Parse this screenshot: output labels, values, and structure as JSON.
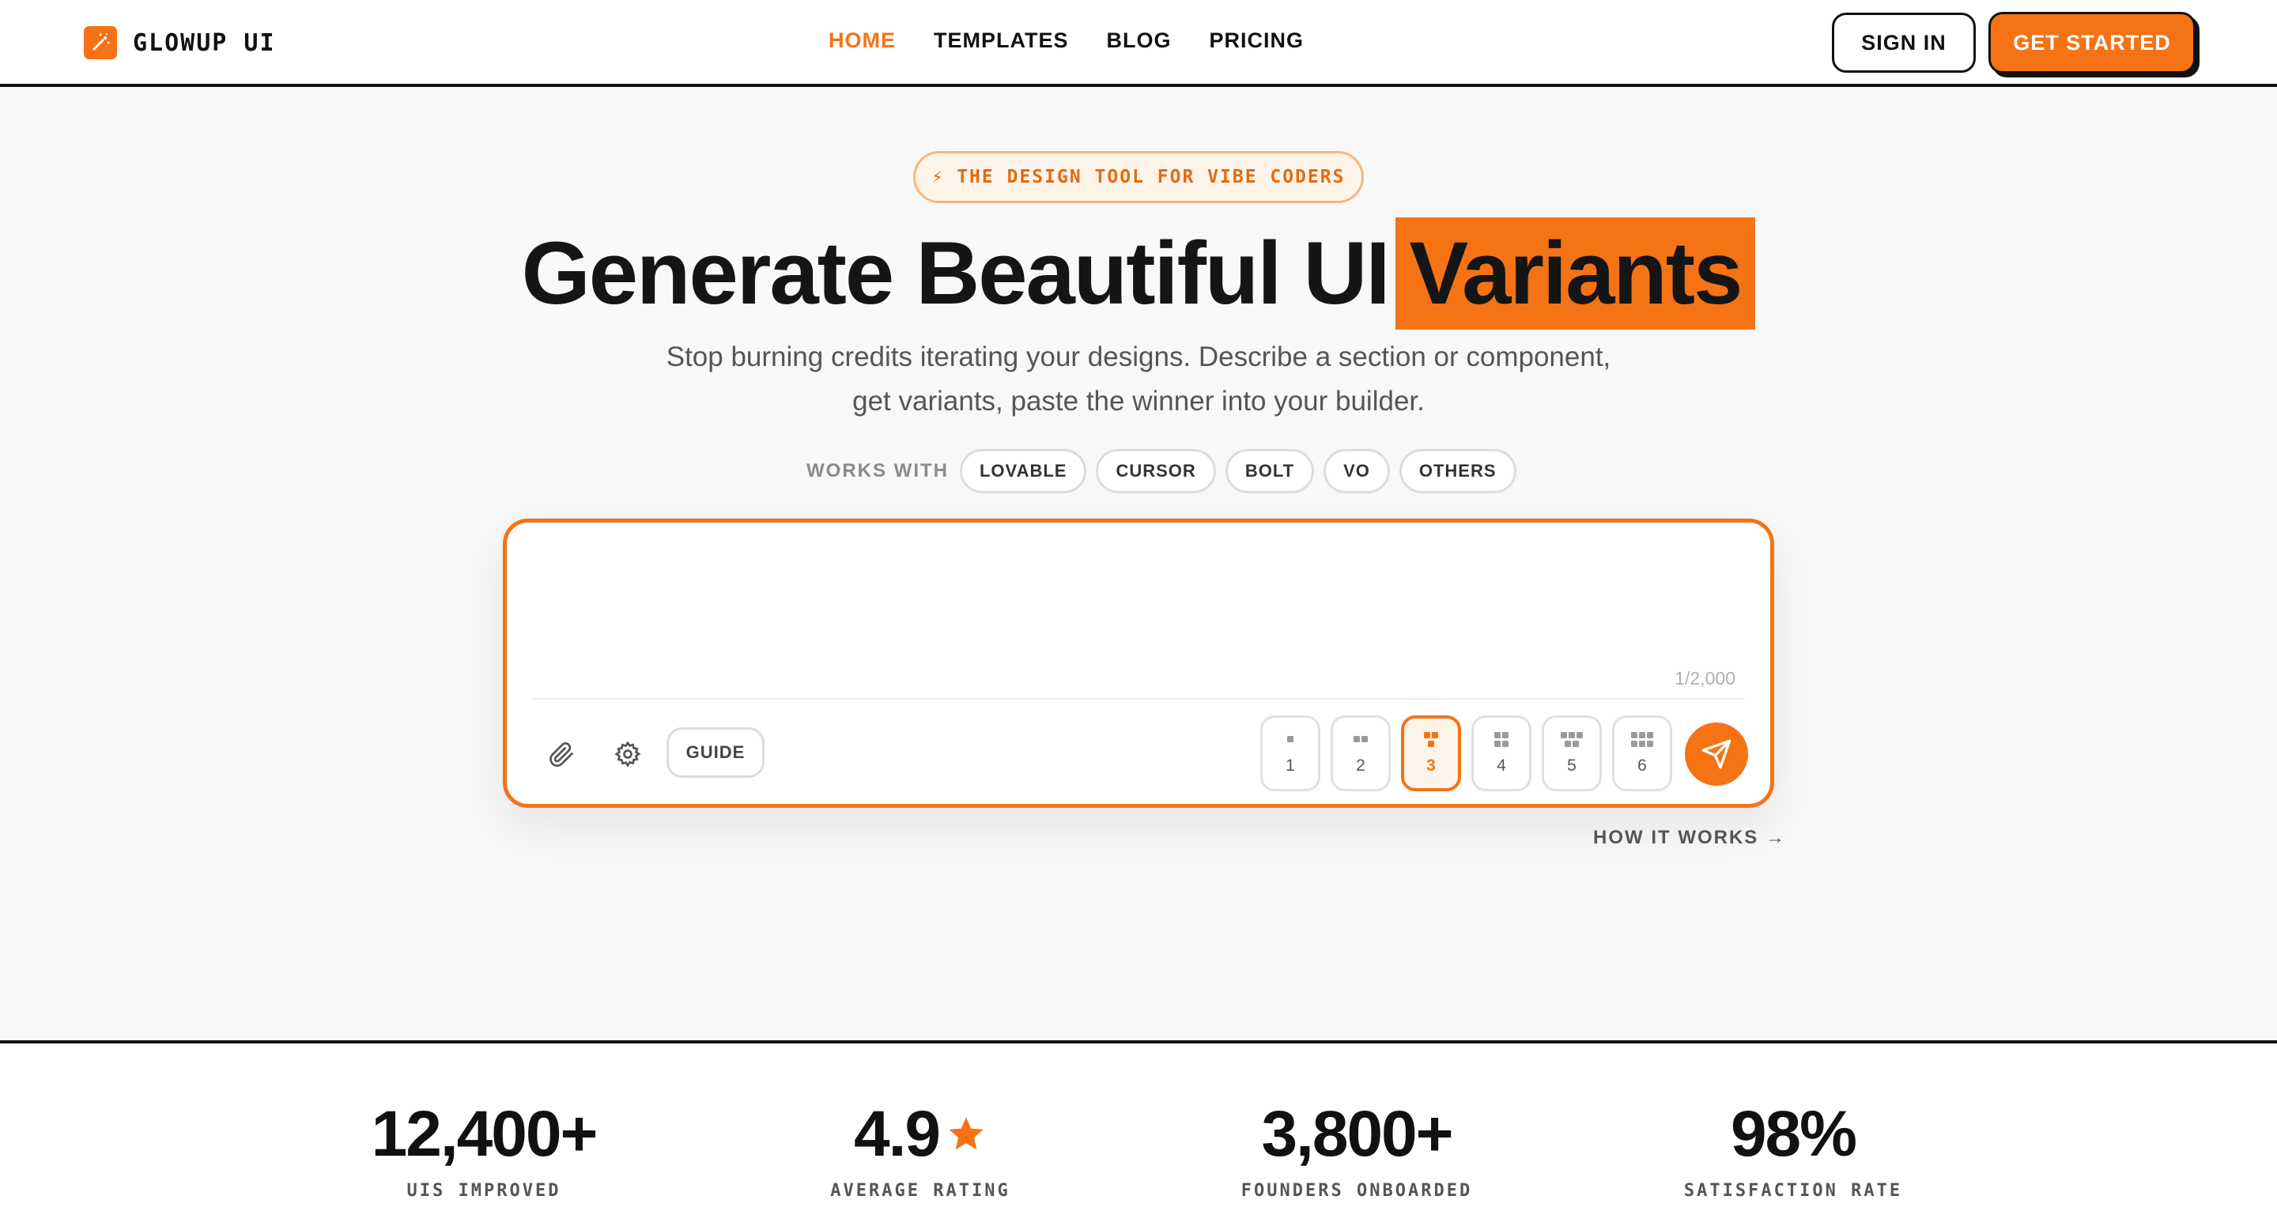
{
  "header": {
    "brand": "GLOWUP UI",
    "nav": [
      "HOME",
      "TEMPLATES",
      "BLOG",
      "PRICING"
    ],
    "sign_in": "SIGN IN",
    "get_started": "GET STARTED"
  },
  "hero": {
    "tagline": "⚡ THE DESIGN TOOL FOR VIBE CODERS",
    "title_main": "Generate Beautiful UI",
    "title_highlight": "Variants",
    "subtitle_line1": "Stop burning credits iterating your designs. Describe a section or component,",
    "subtitle_line2": "get variants, paste the winner into your builder.",
    "works_with_label": "WORKS WITH",
    "builders": [
      "LOVABLE",
      "CURSOR",
      "BOLT",
      "VO",
      "OTHERS"
    ]
  },
  "prompt": {
    "value": "",
    "counter": "1/2,000",
    "guide": "GUIDE",
    "variant_counts": [
      "1",
      "2",
      "3",
      "4",
      "5",
      "6"
    ],
    "selected_variant": "3",
    "how_it_works": "HOW IT WORKS →",
    "accent_color": "#f57315"
  },
  "stats": [
    {
      "value": "12,400+",
      "label": "UIS IMPROVED"
    },
    {
      "value": "4.9",
      "label": "AVERAGE RATING",
      "icon": "star-icon"
    },
    {
      "value": "3,800+",
      "label": "FOUNDERS ONBOARDED"
    },
    {
      "value": "98%",
      "label": "SATISFACTION RATE"
    }
  ]
}
